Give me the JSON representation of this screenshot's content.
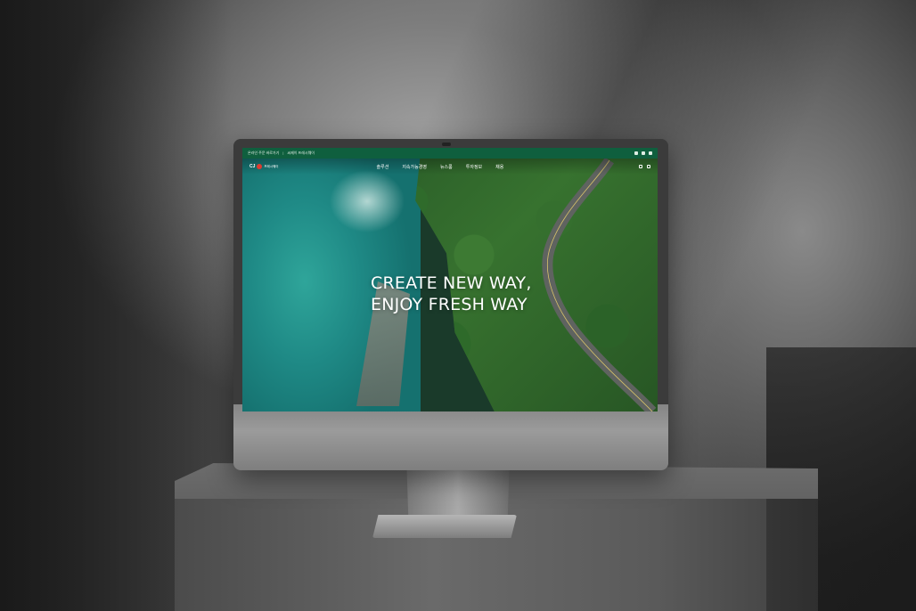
{
  "screen": {
    "topbar": {
      "links": [
        "온라인 주문 바로가기",
        "씨제이 프레시웨이"
      ],
      "separator": "|"
    },
    "nav": {
      "logo_mark": "CJ",
      "logo_text": "프레시웨이",
      "menu": [
        "솔루션",
        "지속가능경영",
        "뉴스룸",
        "투자정보",
        "채용"
      ]
    },
    "hero": {
      "line1": "CREATE NEW WAY,",
      "line2": "ENJOY FRESH WAY"
    }
  },
  "colors": {
    "brand_green": "#0f5f3e",
    "logo_red": "#e03a2f",
    "sea": "#1f8a86",
    "forest": "#2f6b2b"
  },
  "icons": [
    "search-icon",
    "menu-icon",
    "language-icon"
  ]
}
